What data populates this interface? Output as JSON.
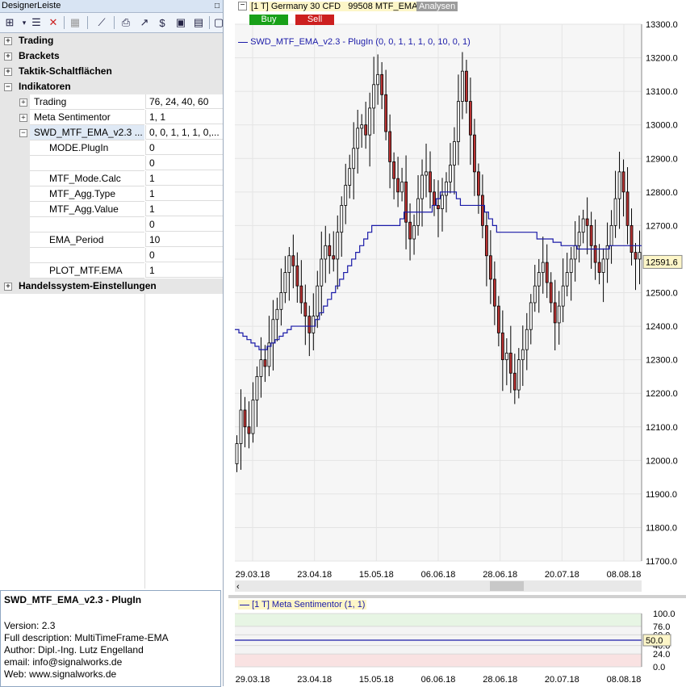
{
  "panel": {
    "title": "DesignerLeiste",
    "pin": "□"
  },
  "tree": {
    "trading": "Trading",
    "brackets": "Brackets",
    "taktik": "Taktik-Schaltflächen",
    "indikatoren": "Indikatoren",
    "ind_trading": {
      "label": "Trading",
      "value": "76, 24, 40, 60"
    },
    "ind_meta": {
      "label": "Meta Sentimentor",
      "value": "1, 1"
    },
    "ind_swd": {
      "label": "SWD_MTF_EMA_v2.3 ...",
      "value": "0, 0, 1, 1, 1, 0,..."
    },
    "params": [
      {
        "label": "MODE.PlugIn",
        "value": "0"
      },
      {
        "label": "",
        "value": "0"
      },
      {
        "label": "MTF_Mode.Calc",
        "value": "1"
      },
      {
        "label": "MTF_Agg.Type",
        "value": "1"
      },
      {
        "label": "MTF_Agg.Value",
        "value": "1"
      },
      {
        "label": "",
        "value": "0"
      },
      {
        "label": "EMA_Period",
        "value": "10"
      },
      {
        "label": "",
        "value": "0"
      },
      {
        "label": "PLOT_MTF.EMA",
        "value": "1"
      }
    ],
    "handelssystem": "Handelssystem-Einstellungen"
  },
  "description": {
    "title": "SWD_MTF_EMA_v2.3 - PlugIn",
    "lines": [
      "Version: 2.3",
      "Full description: MultiTimeFrame-EMA",
      "Author: Dipl.-Ing. Lutz Engelland",
      "email: info@signalworks.de",
      "Web: www.signalworks.de"
    ]
  },
  "chart_header": {
    "instrument": "[1 T] Germany 30 CFD",
    "account": "99508 MTF_EMA",
    "analysen": "Analysen",
    "buy": "Buy",
    "sell": "Sell",
    "indicator_legend": "SWD_MTF_EMA_v2.3 - PlugIn  (0, 0, 1, 1, 1, 0, 10, 0, 1)",
    "sub_legend": "[1 T] Meta Sentimentor  (1, 1)"
  },
  "colors": {
    "bull": "#ffffff",
    "bear": "#b83232",
    "ema": "#1a1aa8",
    "buy": "#18a018",
    "sell": "#cc1f1f",
    "grid": "#e4e4e4"
  },
  "chart_data": [
    {
      "type": "candlestick",
      "title": "",
      "y_axis_ticks": [
        "13300.0",
        "13200.0",
        "13100.0",
        "13000.0",
        "12900.0",
        "12800.0",
        "12700.0",
        "12600.0",
        "12500.0",
        "12400.0",
        "12300.0",
        "12200.0",
        "12100.0",
        "12000.0",
        "11900.0",
        "11800.0",
        "11700.0"
      ],
      "ylim": [
        11700,
        13300
      ],
      "x_axis_ticks": [
        "29.03.18",
        "23.04.18",
        "15.05.18",
        "06.06.18",
        "28.06.18",
        "20.07.18",
        "08.08.18"
      ],
      "last_price": "12591.6",
      "close": [
        12050,
        12150,
        12100,
        12080,
        12180,
        12250,
        12300,
        12280,
        12350,
        12420,
        12450,
        12500,
        12560,
        12610,
        12580,
        12520,
        12470,
        12430,
        12380,
        12430,
        12520,
        12600,
        12640,
        12610,
        12600,
        12680,
        12760,
        12820,
        12870,
        12930,
        12990,
        13000,
        12970,
        13050,
        13120,
        13150,
        13090,
        12980,
        12890,
        12840,
        12800,
        12830,
        12710,
        12660,
        12700,
        12780,
        12850,
        12860,
        12800,
        12760,
        12750,
        12790,
        12830,
        12880,
        12950,
        13070,
        13160,
        13070,
        12970,
        12860,
        12790,
        12700,
        12610,
        12540,
        12460,
        12380,
        12300,
        12320,
        12260,
        12210,
        12300,
        12330,
        12390,
        12470,
        12520,
        12560,
        12590,
        12530,
        12470,
        12410,
        12460,
        12520,
        12560,
        12600,
        12640,
        12680,
        12720,
        12700,
        12640,
        12590,
        12560,
        12600,
        12640,
        12700,
        12780,
        12860,
        12800,
        12700,
        12620,
        12600,
        12620
      ],
      "ema_series": {
        "name": "",
        "values": [
          12390,
          12380,
          12370,
          12360,
          12350,
          12340,
          12330,
          12330,
          12340,
          12350,
          12360,
          12370,
          12380,
          12390,
          12400,
          12400,
          12400,
          12400,
          12400,
          12400,
          12420,
          12440,
          12460,
          12480,
          12500,
          12520,
          12540,
          12560,
          12580,
          12600,
          12620,
          12640,
          12660,
          12680,
          12700,
          12700,
          12700,
          12700,
          12700,
          12700,
          12700,
          12720,
          12740,
          12740,
          12740,
          12740,
          12740,
          12740,
          12740,
          12760,
          12780,
          12800,
          12800,
          12800,
          12800,
          12780,
          12760,
          12760,
          12760,
          12760,
          12760,
          12760,
          12740,
          12720,
          12700,
          12680,
          12680,
          12680,
          12680,
          12680,
          12680,
          12680,
          12680,
          12680,
          12680,
          12660,
          12660,
          12660,
          12660,
          12650,
          12650,
          12640,
          12640,
          12640,
          12640,
          12630,
          12630,
          12630,
          12630,
          12630,
          12630,
          12630,
          12630,
          12640,
          12640,
          12640,
          12640,
          12640,
          12640,
          12640,
          12640
        ]
      }
    },
    {
      "type": "line",
      "title": "",
      "y_axis_ticks": [
        "100.0",
        "76.0",
        "60.0",
        "50.0",
        "40.0",
        "24.0",
        "0.0"
      ],
      "ylim": [
        0,
        100
      ],
      "x_axis_ticks": [
        "29.03.18",
        "23.04.18",
        "15.05.18",
        "06.06.18",
        "28.06.18",
        "20.07.18",
        "08.08.18"
      ],
      "series": [
        {
          "name": "",
          "values": [
            50
          ]
        }
      ],
      "current_value": "50.0"
    }
  ]
}
